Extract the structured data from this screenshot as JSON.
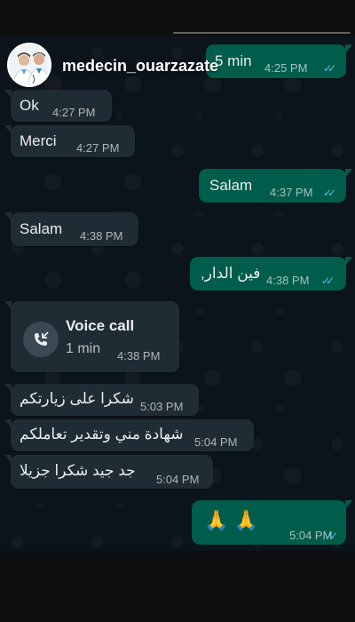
{
  "header": {
    "contact_name": "medecin_ouarzazate",
    "avatar_icon": "doctors-avatar-icon"
  },
  "colors": {
    "incoming_bubble": "#202c33",
    "outgoing_bubble": "#005c4b",
    "read_ticks": "#53bdeb",
    "chat_background": "#0b141a"
  },
  "messages": [
    {
      "direction": "out",
      "text": "5 min",
      "time": "4:25 PM",
      "read": true
    },
    {
      "direction": "in",
      "text": "Ok",
      "time": "4:27 PM"
    },
    {
      "direction": "in",
      "text": "Merci",
      "time": "4:27 PM"
    },
    {
      "direction": "out",
      "text": "Salam",
      "time": "4:37 PM",
      "read": true
    },
    {
      "direction": "in",
      "text": "Salam",
      "time": "4:38 PM"
    },
    {
      "direction": "out",
      "text": "فين الدار,",
      "time": "4:38 PM",
      "read": true
    },
    {
      "direction": "in",
      "type": "voice_call",
      "title": "Voice call",
      "duration": "1 min",
      "time": "4:38 PM",
      "icon": "missed-call-arrow-icon"
    },
    {
      "direction": "in",
      "text": "شكرا على زيارتكم",
      "time": "5:03 PM"
    },
    {
      "direction": "in",
      "text": "شهادة مني وتقدير تعاملكم",
      "time": "5:04 PM"
    },
    {
      "direction": "in",
      "text": "جد جيد شكرا جزيلا",
      "time": "5:04 PM"
    },
    {
      "direction": "out",
      "text": "🙏 🙏",
      "time": "5:04 PM",
      "read": true
    }
  ]
}
